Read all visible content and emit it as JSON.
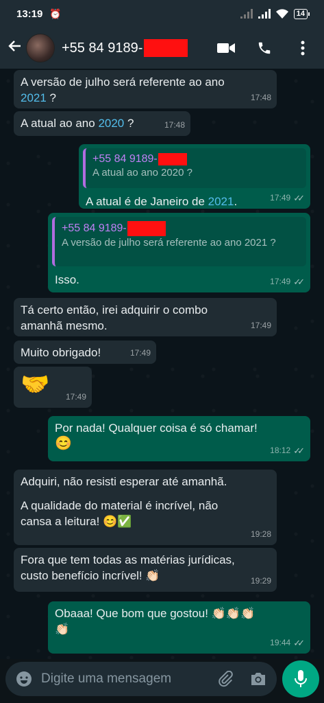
{
  "status_bar": {
    "time": "13:19",
    "battery": "14"
  },
  "header": {
    "contact": "+55 84 9189-"
  },
  "messages": [
    {
      "id": "m1",
      "dir": "in",
      "text_a": "A versão de julho será referente ao ano ",
      "link": "2021",
      "text_b": " ?",
      "time": "17:48"
    },
    {
      "id": "m2",
      "dir": "in",
      "text_a": "A atual ao ano ",
      "link": "2020",
      "text_b": " ?",
      "time": "17:48"
    },
    {
      "id": "m3",
      "dir": "out",
      "quote_name": "+55 84 9189-",
      "quote_text": "A atual ao ano 2020 ?",
      "text_a": "A atual é de Janeiro de ",
      "link": "2021",
      "text_b": ".",
      "time": "17:49"
    },
    {
      "id": "m4",
      "dir": "out",
      "quote_name": "+55 84 9189-",
      "quote_text": "A versão de julho será referente ao ano 2021 ?",
      "text": "Isso.",
      "time": "17:49"
    },
    {
      "id": "m5",
      "dir": "in",
      "text": "Tá certo então, irei adquirir o combo amanhã mesmo.",
      "time": "17:49"
    },
    {
      "id": "m6",
      "dir": "in",
      "text": "Muito obrigado!",
      "time": "17:49"
    },
    {
      "id": "m7",
      "dir": "in",
      "emoji": "🤝",
      "time": "17:49"
    },
    {
      "id": "m8",
      "dir": "out",
      "text": "Por nada! Qualquer coisa é só chamar!",
      "emoji": "😊",
      "time": "18:12"
    },
    {
      "id": "m9",
      "dir": "in",
      "text_1": "Adquiri, não resisti esperar até amanhã.",
      "text_2": "A qualidade do material é incrível, não cansa a leitura! ",
      "emoji": "😊✅",
      "time": "19:28"
    },
    {
      "id": "m10",
      "dir": "in",
      "text": "Fora que tem todas as matérias jurídicas, custo benefício incrível! ",
      "emoji": "👏🏻",
      "time": "19:29"
    },
    {
      "id": "m11",
      "dir": "out",
      "text": "Obaaa! Que bom que gostou! ",
      "emoji": "👏🏻👏🏻👏🏻",
      "emoji_2": "👏🏻",
      "time": "19:44"
    }
  ],
  "composer": {
    "placeholder": "Digite uma mensagem"
  },
  "colors": {
    "incoming": "#202c33",
    "outgoing": "#005c4b",
    "accent": "#00a884",
    "link": "#53bdeb",
    "redaction": "#ff1010"
  },
  "icons": [
    "back-arrow-icon",
    "video-call-icon",
    "phone-icon",
    "more-vert-icon",
    "emoji-icon",
    "attach-icon",
    "camera-icon",
    "mic-icon",
    "double-check-icon"
  ]
}
